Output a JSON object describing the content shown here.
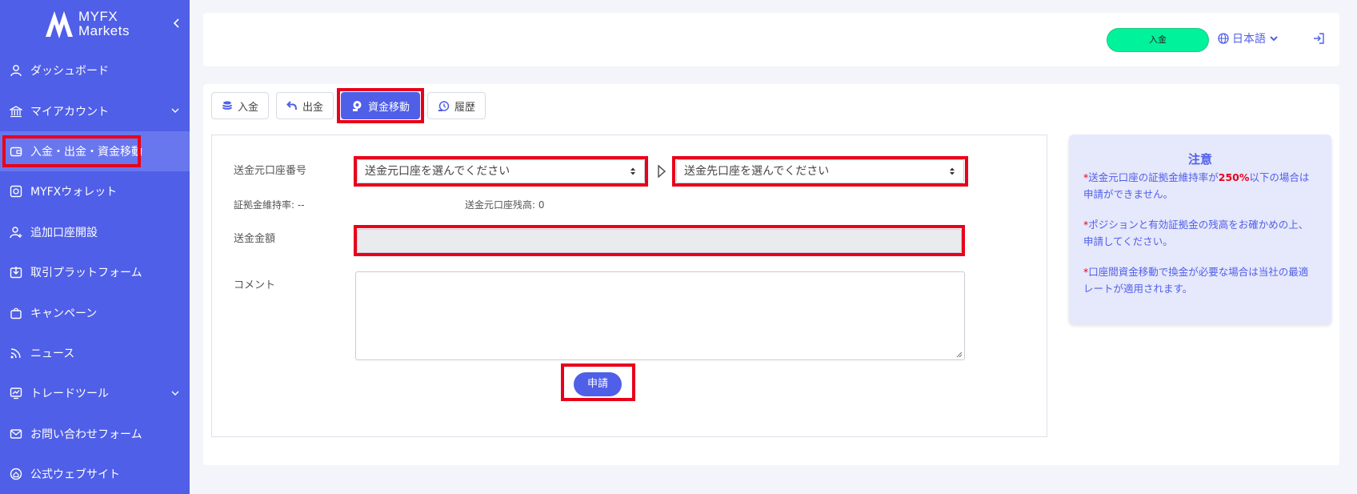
{
  "brand": {
    "line1": "MYFX",
    "line2": "Markets"
  },
  "sidebar": {
    "items": [
      {
        "label": "ダッシュボード",
        "icon": "user-icon",
        "chevron": false
      },
      {
        "label": "マイアカウント",
        "icon": "bank-icon",
        "chevron": true
      },
      {
        "label": "入金・出金・資金移動",
        "icon": "wallet-icon",
        "chevron": false,
        "active": true
      },
      {
        "label": "MYFXウォレット",
        "icon": "safe-icon",
        "chevron": false
      },
      {
        "label": "追加口座開設",
        "icon": "user-add-icon",
        "chevron": false
      },
      {
        "label": "取引プラットフォーム",
        "icon": "download-icon",
        "chevron": false
      },
      {
        "label": "キャンペーン",
        "icon": "gift-bag-icon",
        "chevron": false
      },
      {
        "label": "ニュース",
        "icon": "rss-icon",
        "chevron": false
      },
      {
        "label": "トレードツール",
        "icon": "chart-icon",
        "chevron": true
      },
      {
        "label": "お問い合わせフォーム",
        "icon": "mail-icon",
        "chevron": false
      },
      {
        "label": "公式ウェブサイト",
        "icon": "globe-home-icon",
        "chevron": false
      }
    ]
  },
  "header": {
    "deposit_label": "入金",
    "language": "日本語"
  },
  "tabs": [
    {
      "label": "入金",
      "icon": "coins-icon"
    },
    {
      "label": "出金",
      "icon": "undo-icon"
    },
    {
      "label": "資金移動",
      "icon": "transfer-icon",
      "active": true
    },
    {
      "label": "履歴",
      "icon": "history-icon"
    }
  ],
  "form": {
    "source_label": "送金元口座番号",
    "source_placeholder": "送金元口座を選んでください",
    "dest_placeholder": "送金先口座を選んでください",
    "margin_rate": "証拠金維持率: --",
    "source_balance": "送金元口座残高: 0",
    "amount_label": "送金金額",
    "comment_label": "コメント",
    "submit_label": "申請"
  },
  "notice": {
    "title": "注意",
    "p1_star": "*",
    "p1_a": "送金元口座の証拠金維持率が",
    "p1_red": "250%",
    "p1_b": "以下の場合は申請ができません。",
    "p2_star": "*",
    "p2": "ポジションと有効証拠金の残高をお確かめの上、申請してください。",
    "p3_star": "*",
    "p3": "口座間資金移動で換金が必要な場合は当社の最適レートが適用されます。"
  },
  "colors": {
    "sidebar": "#4f5fe8",
    "accent": "#4f5fe8",
    "deposit": "#00f29b",
    "highlight": "#e8001a"
  }
}
